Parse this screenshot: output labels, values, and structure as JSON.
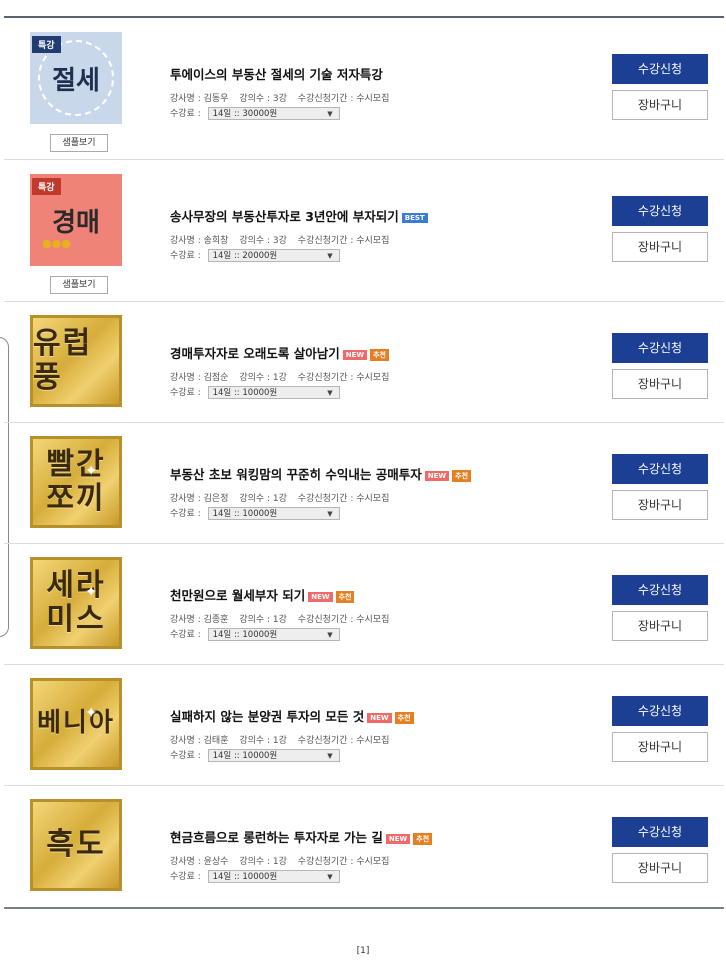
{
  "courses": [
    {
      "thumb_label": "절세",
      "thumb_flag": "특강",
      "has_sample": true,
      "title": "투에이스의 부동산 절세의 기술 저자특강",
      "badges": [],
      "instructor": "강사명 : 김동우",
      "lectures": "강의수 : 3강",
      "period": "수강신청기간 : 수시모집",
      "fee_label": "수강료 :",
      "fee_option": "14일  :: 30000원"
    },
    {
      "thumb_label": "경매",
      "thumb_flag": "특강",
      "has_sample": true,
      "title": "송사무장의 부동산투자로 3년안에 부자되기",
      "badges": [
        "BEST"
      ],
      "instructor": "강사명 : 송희창",
      "lectures": "강의수 : 3강",
      "period": "수강신청기간 : 수시모집",
      "fee_label": "수강료 :",
      "fee_option": "14일  :: 20000원"
    },
    {
      "thumb_label": "유럽풍",
      "has_sample": false,
      "title": "경매투자자로 오래도록 살아남기",
      "badges": [
        "NEW",
        "추천"
      ],
      "instructor": "강사명 : 김점순",
      "lectures": "강의수 : 1강",
      "period": "수강신청기간 : 수시모집",
      "fee_label": "수강료 :",
      "fee_option": "14일  :: 10000원"
    },
    {
      "thumb_label": "빨간 쪼끼",
      "has_sample": false,
      "title": "부동산 초보 워킹맘의 꾸준히 수익내는 공매투자",
      "badges": [
        "NEW",
        "추천"
      ],
      "instructor": "강사명 : 김은정",
      "lectures": "강의수 : 1강",
      "period": "수강신청기간 : 수시모집",
      "fee_label": "수강료 :",
      "fee_option": "14일  :: 10000원"
    },
    {
      "thumb_label": "세라 미스",
      "has_sample": false,
      "title": "천만원으로 월세부자 되기",
      "badges": [
        "NEW",
        "추천"
      ],
      "instructor": "강사명 : 김종훈",
      "lectures": "강의수 : 1강",
      "period": "수강신청기간 : 수시모집",
      "fee_label": "수강료 :",
      "fee_option": "14일  :: 10000원"
    },
    {
      "thumb_label": "베니아",
      "has_sample": false,
      "title": "실패하지 않는 분양권 투자의 모든 것",
      "badges": [
        "NEW",
        "추천"
      ],
      "instructor": "강사명 : 김태훈",
      "lectures": "강의수 : 1강",
      "period": "수강신청기간 : 수시모집",
      "fee_label": "수강료 :",
      "fee_option": "14일  :: 10000원"
    },
    {
      "thumb_label": "흑도",
      "has_sample": false,
      "title": "현금흐름으로 롱런하는 투자자로 가는 길",
      "badges": [
        "NEW",
        "추천"
      ],
      "instructor": "강사명 : 윤상수",
      "lectures": "강의수 : 1강",
      "period": "수강신청기간 : 수시모집",
      "fee_label": "수강료 :",
      "fee_option": "14일  :: 10000원"
    }
  ],
  "labels": {
    "sample": "샘플보기",
    "apply": "수강신청",
    "cart": "장바구니"
  },
  "pagination": "[1]"
}
